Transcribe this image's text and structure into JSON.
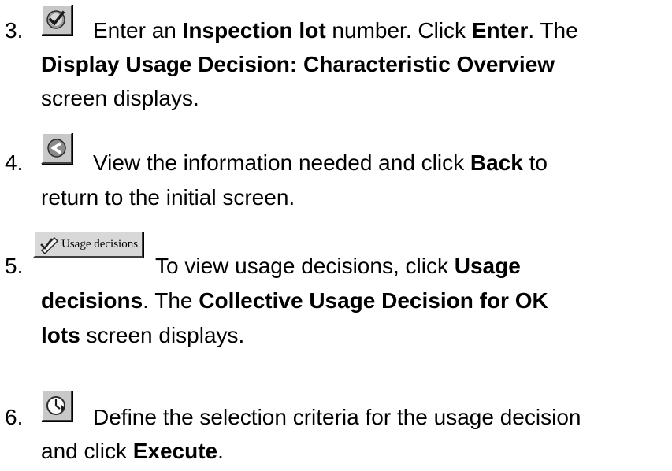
{
  "steps": [
    {
      "number": "3.",
      "icon": "check-icon",
      "parts": [
        "Enter an ",
        "Inspection lot",
        " number.  Click ",
        "Enter",
        ".  The",
        "Display Usage Decision: Characteristic Overview",
        "screen displays."
      ]
    },
    {
      "number": "4.",
      "icon": "back-icon",
      "parts": [
        "View the information needed and click ",
        "Back",
        " to",
        "return to the initial screen."
      ]
    },
    {
      "number": "5.",
      "icon": "usage-decisions-button-image",
      "button_label": "Usage decisions",
      "parts": [
        "To view usage decisions, click ",
        "Usage",
        "decisions",
        ".  The ",
        "Collective Usage Decision for OK",
        "lots",
        " screen displays."
      ]
    },
    {
      "number": "6.",
      "icon": "execute-icon",
      "parts": [
        "Define the selection criteria for the usage decision",
        "and click ",
        "Execute",
        "."
      ]
    }
  ]
}
